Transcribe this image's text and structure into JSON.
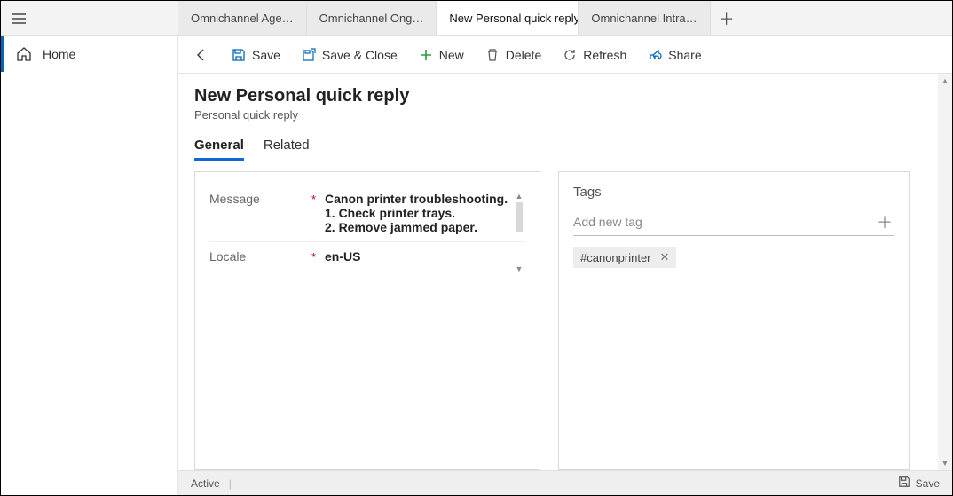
{
  "tabs": [
    {
      "label": "Omnichannel Age…",
      "active": false
    },
    {
      "label": "Omnichannel Ong…",
      "active": false
    },
    {
      "label": "New Personal quick reply",
      "active": true
    },
    {
      "label": "Omnichannel Intra…",
      "active": false
    }
  ],
  "sidebar": {
    "home": "Home"
  },
  "toolbar": {
    "save": "Save",
    "save_close": "Save & Close",
    "new": "New",
    "delete": "Delete",
    "refresh": "Refresh",
    "share": "Share"
  },
  "page": {
    "title": "New Personal quick reply",
    "subtitle": "Personal quick reply"
  },
  "form_tabs": {
    "general": "General",
    "related": "Related"
  },
  "fields": {
    "message_label": "Message",
    "message_value": "Canon printer troubleshooting.\n1. Check printer trays.\n2. Remove jammed paper.",
    "locale_label": "Locale",
    "locale_value": "en-US"
  },
  "tags": {
    "title": "Tags",
    "placeholder": "Add new tag",
    "items": [
      "#canonprinter"
    ]
  },
  "status": {
    "state": "Active",
    "save": "Save"
  }
}
